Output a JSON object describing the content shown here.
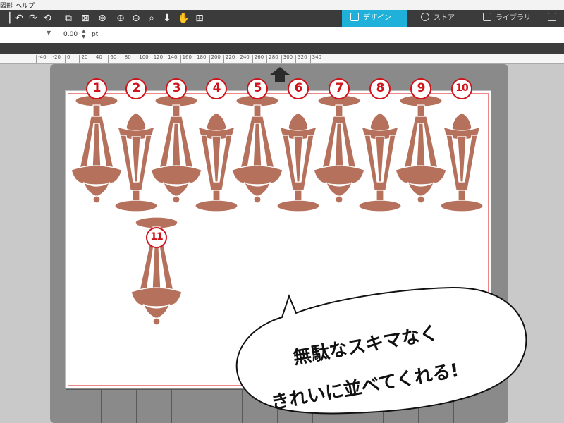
{
  "menubar": {
    "items": [
      "図形",
      "ヘルプ"
    ]
  },
  "toolbar": {
    "icons": [
      "undo-icon",
      "redo-icon",
      "refresh-icon",
      "group-icon",
      "ungroup-icon",
      "compound-icon",
      "zoom-in-icon",
      "zoom-out-icon",
      "zoom-fit-icon",
      "move-down-icon",
      "pan-hand-icon",
      "add-box-icon"
    ]
  },
  "tabs": [
    {
      "label": "デザイン",
      "active": true,
      "icon": "design-grid-icon"
    },
    {
      "label": "ストア",
      "active": false,
      "icon": "store-icon"
    },
    {
      "label": "ライブラリ",
      "active": false,
      "icon": "library-icon"
    },
    {
      "label": "",
      "active": false,
      "icon": "send-icon"
    }
  ],
  "options": {
    "line_weight": "0.00",
    "unit": "pt"
  },
  "ruler": {
    "labels": [
      "-40",
      "-20",
      "0",
      "20",
      "40",
      "60",
      "80",
      "100",
      "120",
      "140",
      "160",
      "180",
      "200",
      "220",
      "240",
      "260",
      "280",
      "300",
      "320",
      "340"
    ]
  },
  "markers": [
    "1",
    "2",
    "3",
    "4",
    "5",
    "6",
    "7",
    "8",
    "9",
    "10",
    "11"
  ],
  "callout": {
    "line1": "無駄なスキマなく",
    "line2": "きれいに並べてくれる!"
  },
  "colors": {
    "shape": "#b5715c",
    "marker": "#d0121b",
    "accent": "#1fb1d9"
  }
}
